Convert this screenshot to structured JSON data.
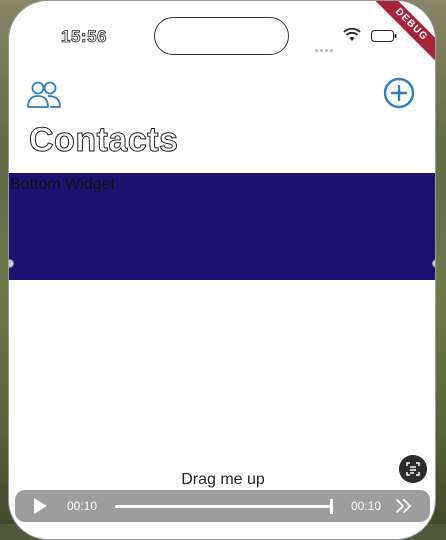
{
  "status_bar": {
    "time": "15:56",
    "debug_banner": "DEBUG"
  },
  "header": {
    "title": "Contacts",
    "left_icon": "contacts-group-icon",
    "right_icon": "add-circle-icon"
  },
  "bottom_widget": {
    "label": "Bottom Widget",
    "background": "#1a1470"
  },
  "drag_hint": "Drag me up",
  "video_controls": {
    "elapsed": "00:10",
    "duration": "00:10",
    "progress": 1.0
  },
  "colors": {
    "accent": "#2d7fc2",
    "widget": "#1a1470",
    "debug": "#a5243c"
  }
}
